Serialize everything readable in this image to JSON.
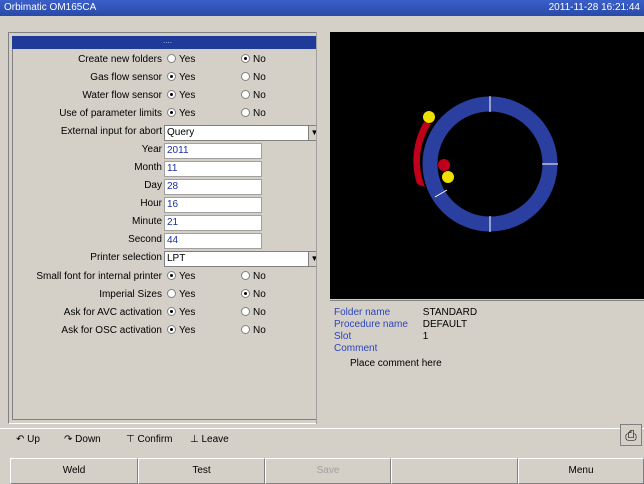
{
  "app": {
    "title": "Orbimatic OM165CA",
    "datetime": "2011-11-28 16:21:44"
  },
  "header": {
    "selection": "...."
  },
  "settings": {
    "create_folders": {
      "label": "Create new folders",
      "yes": "Yes",
      "no": "No"
    },
    "gas_flow": {
      "label": "Gas flow sensor",
      "yes": "Yes",
      "no": "No"
    },
    "water_flow": {
      "label": "Water flow sensor",
      "yes": "Yes",
      "no": "No"
    },
    "param_limits": {
      "label": "Use of parameter limits",
      "yes": "Yes",
      "no": "No"
    },
    "external_abort": {
      "label": "External input for abort",
      "value": "Query"
    },
    "year": {
      "label": "Year",
      "value": "2011"
    },
    "month": {
      "label": "Month",
      "value": "11"
    },
    "day": {
      "label": "Day",
      "value": "28"
    },
    "hour": {
      "label": "Hour",
      "value": "16"
    },
    "minute": {
      "label": "Minute",
      "value": "21"
    },
    "second": {
      "label": "Second",
      "value": "44"
    },
    "printer": {
      "label": "Printer selection",
      "value": "LPT"
    },
    "small_font": {
      "label": "Small font for internal printer",
      "yes": "Yes",
      "no": "No"
    },
    "imperial": {
      "label": "Imperial Sizes",
      "yes": "Yes",
      "no": "No"
    },
    "avc": {
      "label": "Ask for AVC activation",
      "yes": "Yes",
      "no": "No"
    },
    "osc": {
      "label": "Ask for OSC activation",
      "yes": "Yes",
      "no": "No"
    }
  },
  "info": {
    "folder_key": "Folder name",
    "folder_val": "STANDARD",
    "procedure_key": "Procedure name",
    "procedure_val": "DEFAULT",
    "slot_key": "Slot",
    "slot_val": "1",
    "comment_key": "Comment",
    "comment_val": "Place comment here"
  },
  "nav": {
    "up": "Up",
    "down": "Down",
    "confirm": "Confirm",
    "leave": "Leave"
  },
  "fkeys": {
    "weld": "Weld",
    "test": "Test",
    "save": "Save",
    "empty": "",
    "menu": "Menu"
  },
  "colors": {
    "ring": "#2a3fa0",
    "torch": "#c0001a",
    "marker": "#f0e000"
  }
}
